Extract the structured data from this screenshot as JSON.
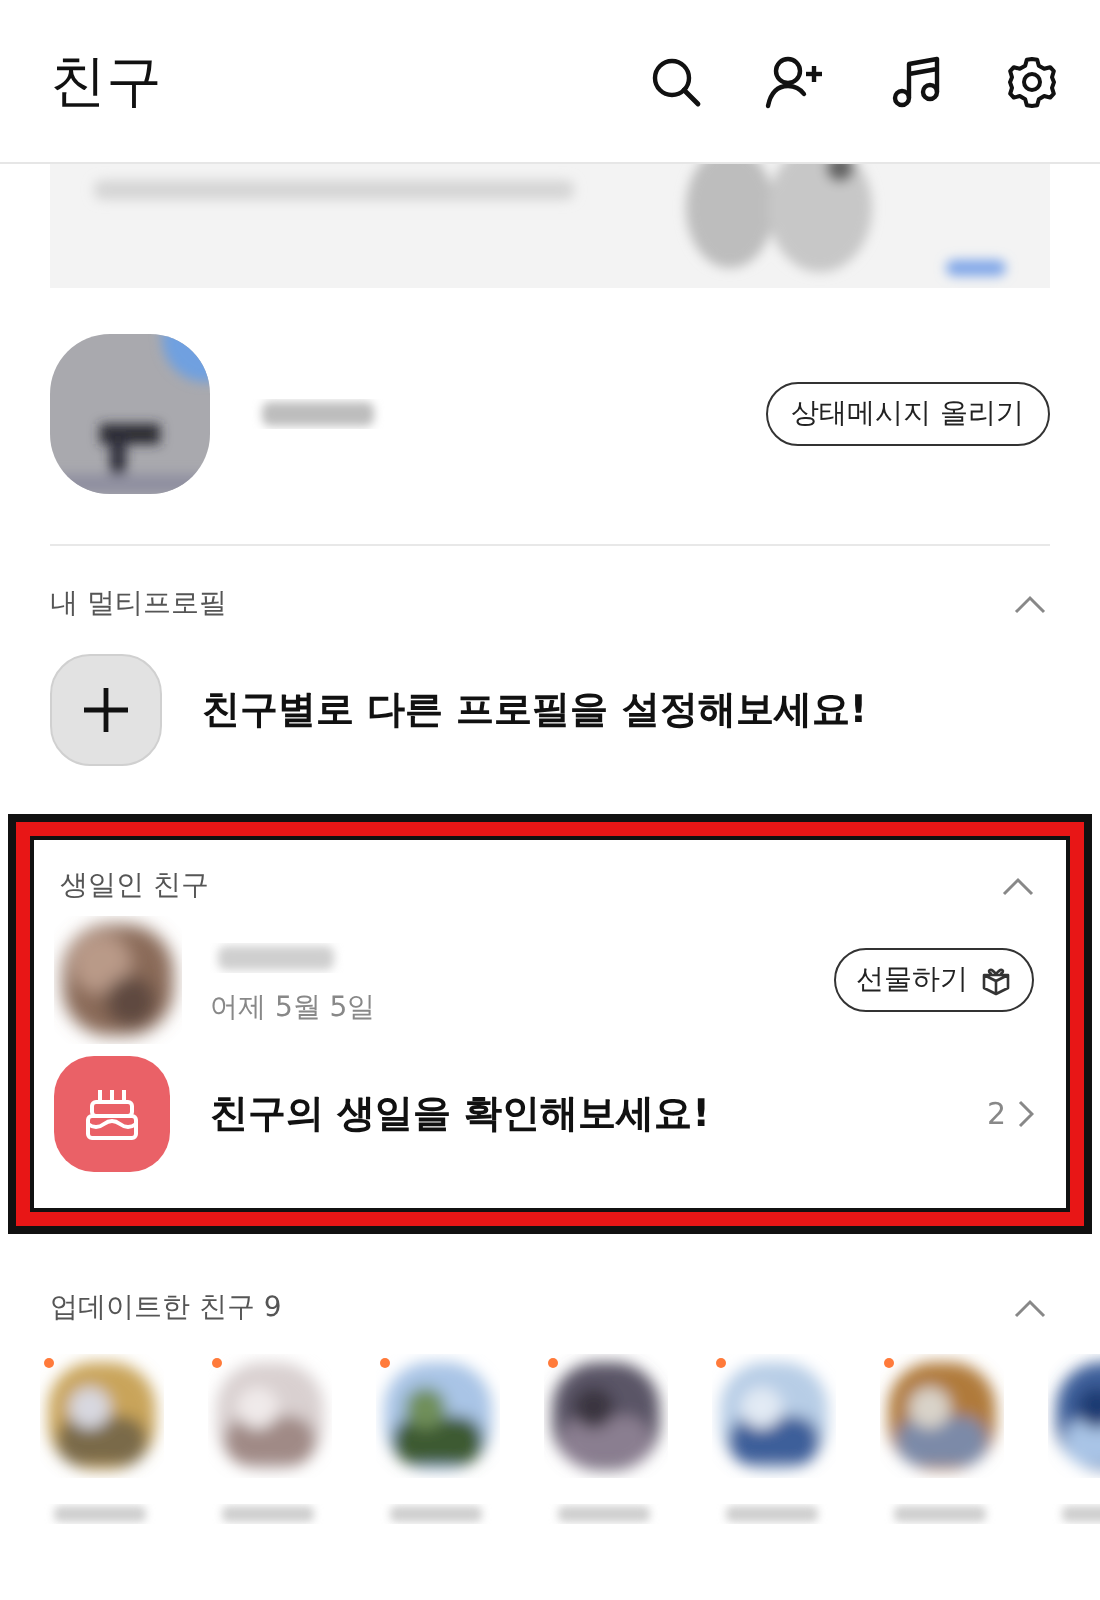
{
  "header": {
    "title": "친구"
  },
  "my_profile": {
    "button": "상태메시지 올리기"
  },
  "multi_profile": {
    "label": "내 멀티프로필",
    "expanded": true,
    "prompt": "친구별로 다른 프로필을 설정해보세요!"
  },
  "birthday": {
    "label": "생일인 친구",
    "expanded": true,
    "friend": {
      "date": "어제 5월 5일",
      "button": "선물하기"
    },
    "prompt": "친구의 생일을 확인해보세요!",
    "count": "2"
  },
  "updated": {
    "label": "업데이트한 친구 9",
    "expanded": true,
    "friends": [
      {
        "new": true
      },
      {
        "new": true
      },
      {
        "new": true
      },
      {
        "new": true
      },
      {
        "new": true
      },
      {
        "new": true
      },
      {
        "new": false
      }
    ]
  }
}
